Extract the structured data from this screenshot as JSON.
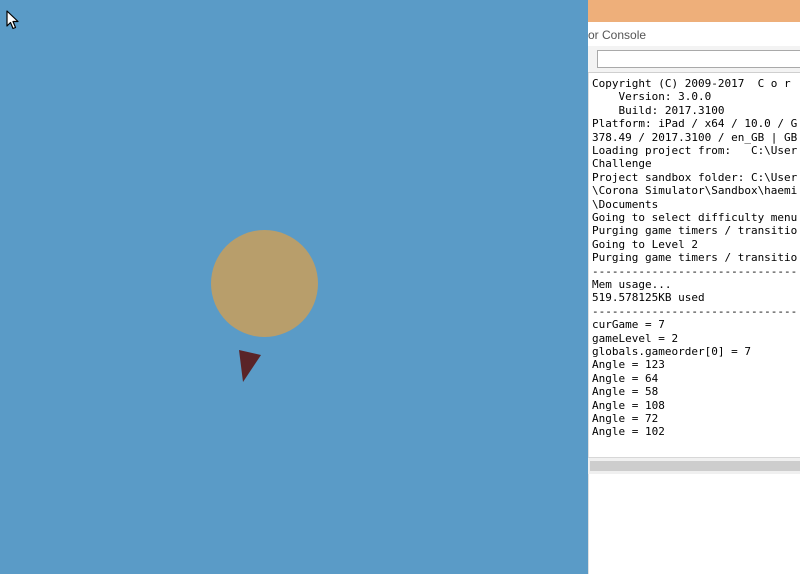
{
  "colors": {
    "simulator_background": "#5a9bc7",
    "circle": "#b89e6b",
    "arrow": "#5a2428",
    "titlebar": "#eeaf7a"
  },
  "simulator": {
    "cursor_icon": "arrow-cursor-icon"
  },
  "console": {
    "title": "or Console",
    "filter_placeholder": "",
    "filter_value": "",
    "lines": [
      "Copyright (C) 2009-2017  C o r",
      "    Version: 3.0.0",
      "    Build: 2017.3100",
      "Platform: iPad / x64 / 10.0 / G",
      "378.49 / 2017.3100 / en_GB | GB",
      "Loading project from:   C:\\User",
      "Challenge",
      "Project sandbox folder: C:\\User",
      "\\Corona Simulator\\Sandbox\\haemi",
      "\\Documents",
      "Going to select difficulty menu",
      "Purging game timers / transitio",
      "Going to Level 2",
      "Purging game timers / transitio",
      "-------------------------------",
      "Mem usage...",
      "519.578125KB used",
      "-------------------------------",
      "curGame = 7",
      "gameLevel = 2",
      "globals.gameorder[0] = 7",
      "Angle = 123",
      "Angle = 64",
      "Angle = 58",
      "Angle = 108",
      "Angle = 72",
      "Angle = 102"
    ]
  }
}
